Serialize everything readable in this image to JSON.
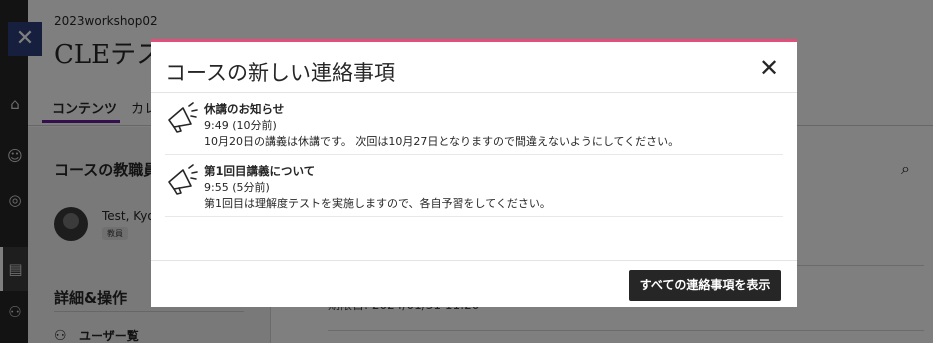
{
  "course": {
    "code": "2023workshop02",
    "title": "CLEテス"
  },
  "tabs": [
    {
      "label": "コンテンツ"
    },
    {
      "label": "カレ"
    }
  ],
  "left_panel": {
    "faculty_heading": "コースの教職員",
    "instructor_name": "Test, Kyo",
    "instructor_role": "教員",
    "details_heading": "詳細&操作",
    "user_list_label": "ユーザー覧"
  },
  "content": {
    "snippet": "期限日: 2024/01/31 11:20"
  },
  "modal": {
    "title": "コースの新しい連絡事項",
    "close_glyph": "✕",
    "announcements": [
      {
        "title": "休講のお知らせ",
        "time": "9:49 (10分前)",
        "body": "10月20日の講義は休講です。 次回は10月27日となりますので間違えないようにしてください。"
      },
      {
        "title": "第1回目講義について",
        "time": "9:55 (5分前)",
        "body": "第1回目は理解度テストを実施しますので、各自予習をしてください。"
      }
    ],
    "show_all_label": "すべての連絡事項を表示"
  },
  "colors": {
    "accent_top_border": "#e24f7a",
    "primary_button": "#262626",
    "tab_underline": "#6b1f9a",
    "close_tile": "#2c3e7a"
  }
}
